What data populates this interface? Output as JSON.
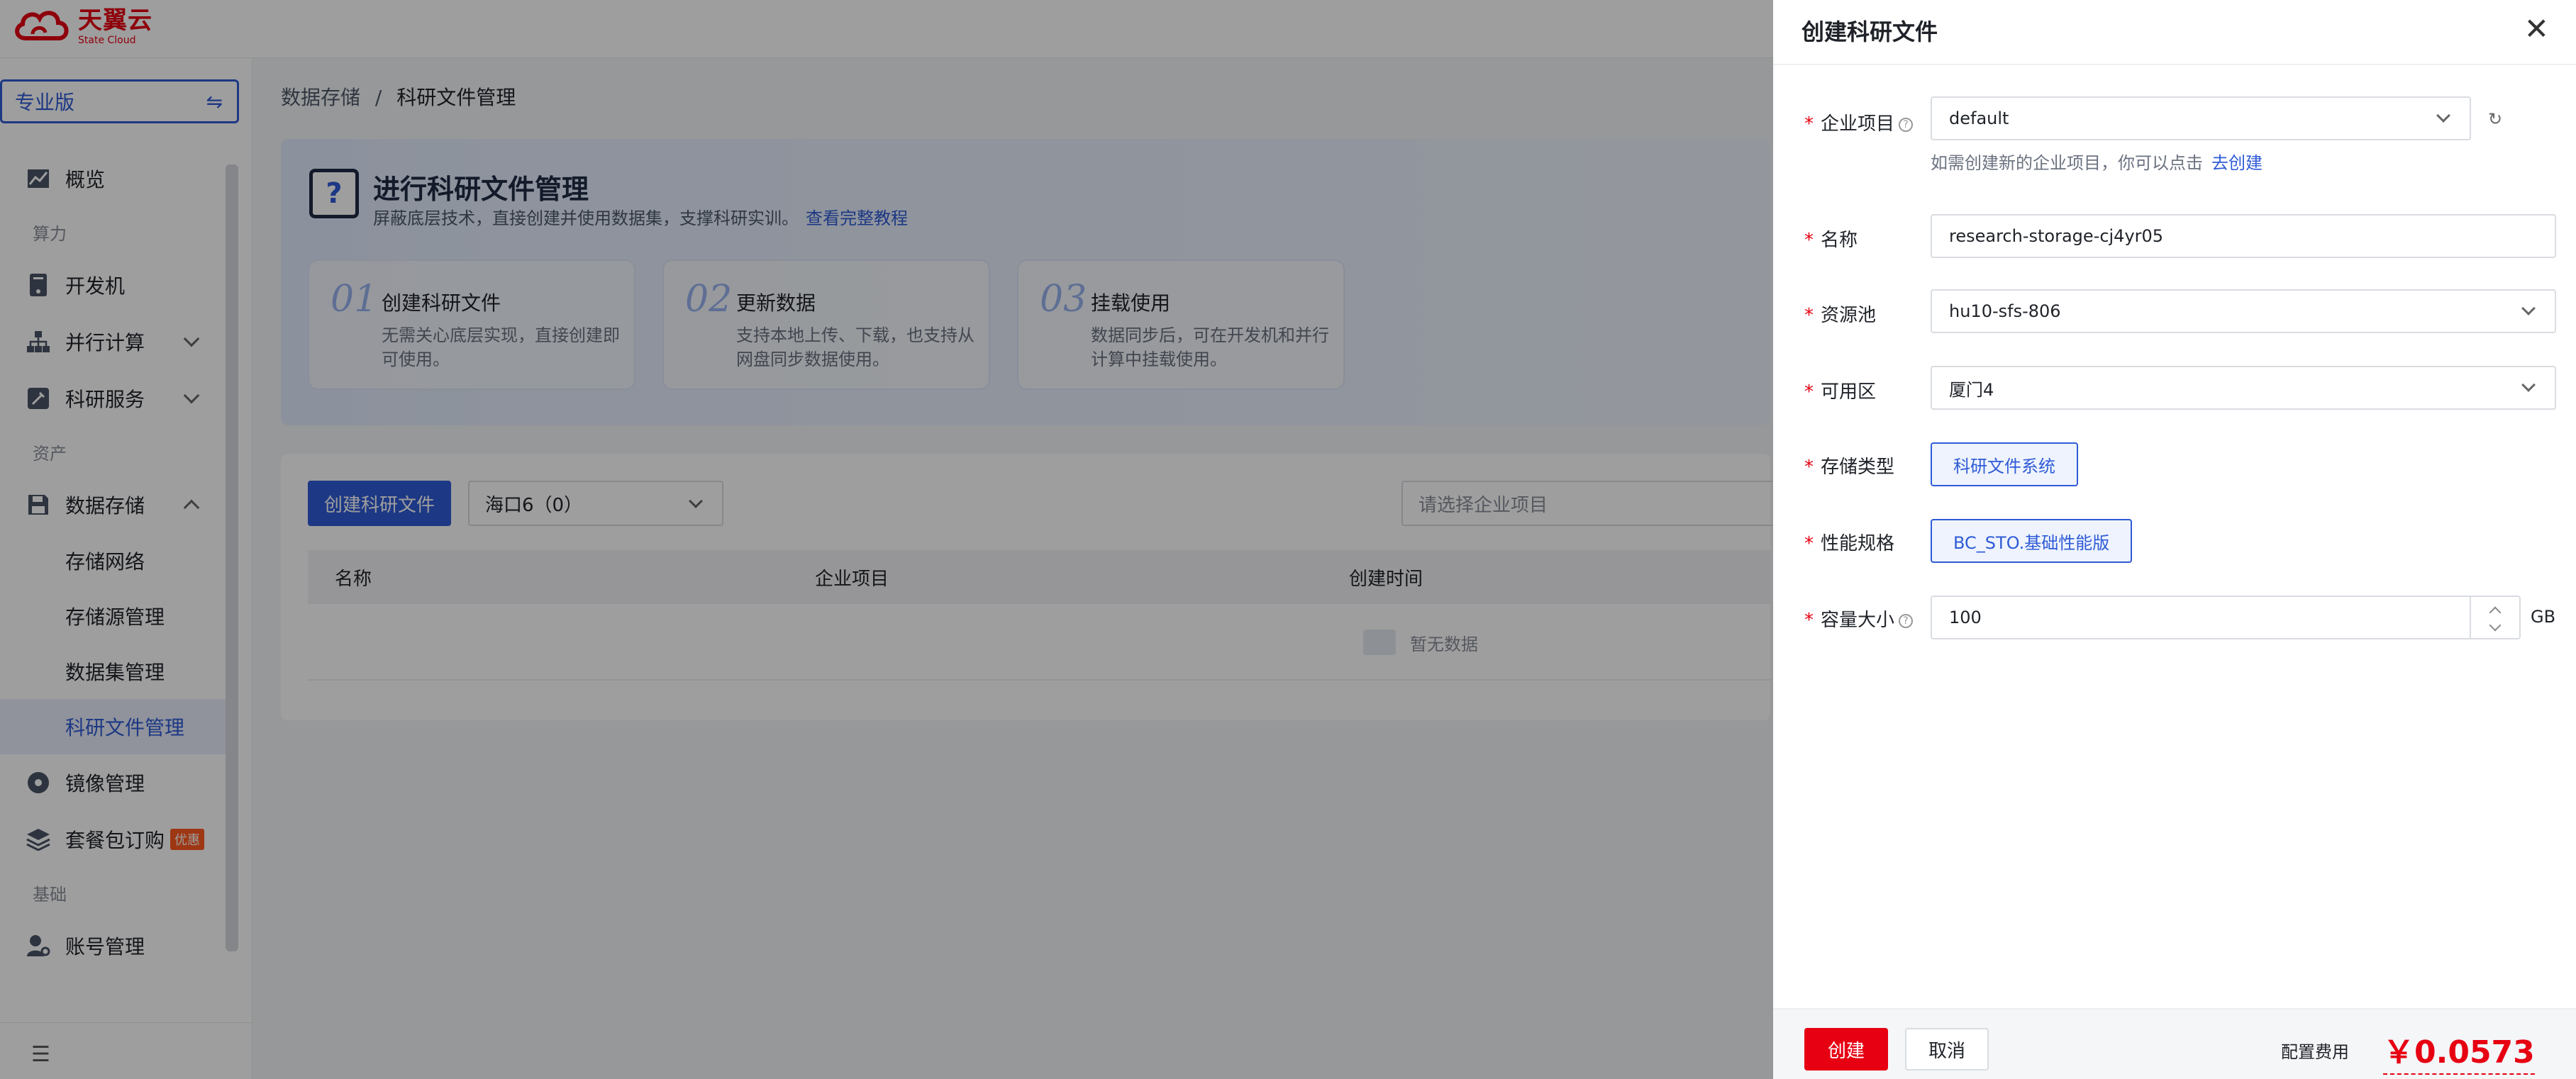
{
  "brand": {
    "name_cn": "天翼云",
    "name_en": "State Cloud"
  },
  "sidebar": {
    "edition": "专业版",
    "items": [
      {
        "label": "概览",
        "type": "item",
        "icon": "chart-icon"
      },
      {
        "label": "算力",
        "type": "group"
      },
      {
        "label": "开发机",
        "type": "item",
        "icon": "server-icon"
      },
      {
        "label": "并行计算",
        "type": "item",
        "icon": "cluster-icon",
        "expandable": true
      },
      {
        "label": "科研服务",
        "type": "item",
        "icon": "tools-icon",
        "expandable": true
      },
      {
        "label": "资产",
        "type": "group"
      },
      {
        "label": "数据存储",
        "type": "item",
        "icon": "storage-icon",
        "expanded": true
      },
      {
        "label": "存储网络",
        "type": "sub"
      },
      {
        "label": "存储源管理",
        "type": "sub"
      },
      {
        "label": "数据集管理",
        "type": "sub"
      },
      {
        "label": "科研文件管理",
        "type": "sub",
        "active": true
      },
      {
        "label": "镜像管理",
        "type": "item",
        "icon": "disc-icon"
      },
      {
        "label": "套餐包订购",
        "type": "item",
        "icon": "layers-icon",
        "badge": "优惠"
      },
      {
        "label": "基础",
        "type": "group"
      },
      {
        "label": "账号管理",
        "type": "item",
        "icon": "user-gear-icon"
      }
    ]
  },
  "breadcrumb": {
    "parent": "数据存储",
    "separator": "/",
    "current": "科研文件管理"
  },
  "intro": {
    "title": "进行科研文件管理",
    "desc": "屏蔽底层技术，直接创建并使用数据集，支撑科研实训。",
    "link": "查看完整教程",
    "steps": [
      {
        "num": "01",
        "title": "创建科研文件",
        "desc": "无需关心底层实现，直接创建即可使用。"
      },
      {
        "num": "02",
        "title": "更新数据",
        "desc": "支持本地上传、下载，也支持从网盘同步数据使用。"
      },
      {
        "num": "03",
        "title": "挂载使用",
        "desc": "数据同步后，可在开发机和并行计算中挂载使用。"
      }
    ]
  },
  "panel": {
    "create_btn": "创建科研文件",
    "region_select": "海口6（0）",
    "project_placeholder": "请选择企业项目",
    "columns": [
      "名称",
      "企业项目",
      "创建时间"
    ],
    "empty": "暂无数据"
  },
  "drawer": {
    "title": "创建科研文件",
    "fields": {
      "project": {
        "label": "企业项目",
        "value": "default",
        "hint": "如需创建新的企业项目，你可以点击",
        "hint_link": "去创建"
      },
      "name": {
        "label": "名称",
        "value": "research-storage-cj4yr05"
      },
      "pool": {
        "label": "资源池",
        "value": "hu10-sfs-806"
      },
      "zone": {
        "label": "可用区",
        "value": "厦门4"
      },
      "storage_type": {
        "label": "存储类型",
        "value": "科研文件系统"
      },
      "spec": {
        "label": "性能规格",
        "value": "BC_STO.基础性能版"
      },
      "capacity": {
        "label": "容量大小",
        "value": "100",
        "unit": "GB"
      }
    },
    "footer": {
      "create": "创建",
      "cancel": "取消",
      "fee_label": "配置费用",
      "fee_value": "￥0.0573"
    }
  }
}
